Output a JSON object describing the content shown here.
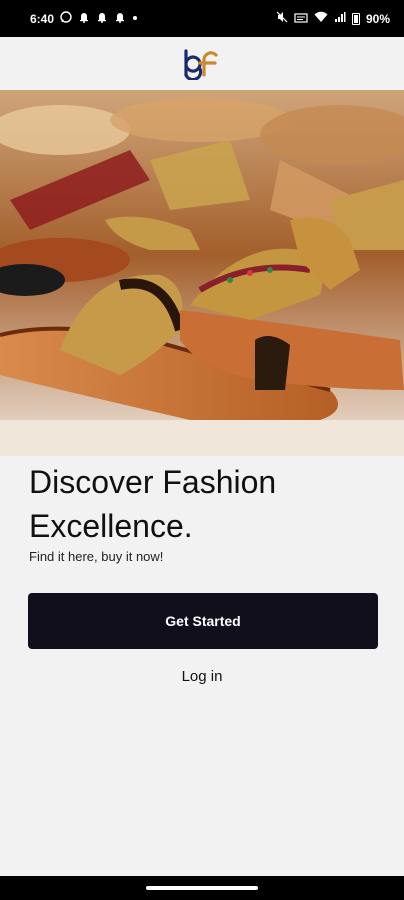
{
  "status_bar": {
    "time": "6:40",
    "battery": "90%",
    "notification_icons": [
      "whatsapp-icon",
      "bell-icon",
      "bell-icon",
      "bell-icon",
      "dot-icon"
    ],
    "system_icons": [
      "mute-icon",
      "wifi-call-icon",
      "wifi-icon",
      "signal-icon",
      "battery-icon"
    ]
  },
  "header": {
    "logo_text": "bf",
    "logo_colors": {
      "b": "#1b2a6b",
      "f": "#c9892e"
    }
  },
  "hero": {
    "image": "sandals-photo"
  },
  "main": {
    "headline": "Discover Fashion Excellence.",
    "subtitle": "Find it here, buy it now!",
    "cta_label": "Get Started",
    "login_label": "Log in"
  },
  "colors": {
    "primary_button": "#110f1c",
    "background": "#f2f2f2"
  }
}
